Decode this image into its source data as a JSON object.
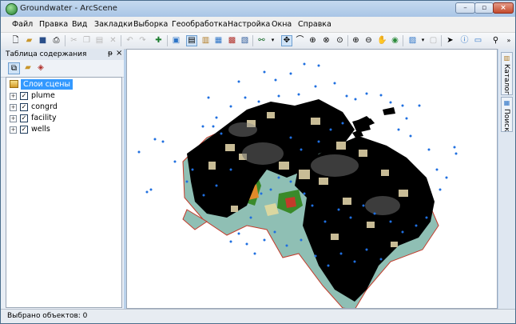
{
  "window": {
    "title": "Groundwater - ArcScene"
  },
  "menu": [
    "Файл",
    "Правка",
    "Вид",
    "Закладки",
    "Выборка",
    "Геообработка",
    "Настройка",
    "Окна",
    "Справка"
  ],
  "toc": {
    "title": "Таблица содержания",
    "scene_label": "Слои сцены",
    "layers": [
      {
        "name": "plume",
        "checked": true
      },
      {
        "name": "congrd",
        "checked": true
      },
      {
        "name": "facility",
        "checked": true
      },
      {
        "name": "wells",
        "checked": true
      }
    ]
  },
  "side_tabs": {
    "catalog": "Каталог",
    "search": "Поиск"
  },
  "status": {
    "selected": "Выбрано объектов: 0"
  },
  "colors": {
    "accent_selection": "#3399ff",
    "terrain_water": "#8fbfb4",
    "plume": "#000000",
    "well_points": "#1f6fe0",
    "boundary": "#c43a2a"
  }
}
